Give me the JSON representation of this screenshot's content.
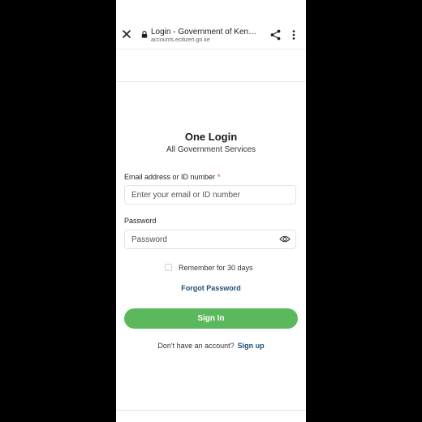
{
  "browser": {
    "page_title": "Login - Government of Kenya ...",
    "domain": "accounts.ecitizen.go.ke",
    "icons": {
      "close": "close-icon",
      "lock": "lock-icon",
      "share": "share-icon",
      "menu": "more-vert-icon"
    }
  },
  "login": {
    "title": "One Login",
    "subtitle": "All Government Services",
    "email_label": "Email address or ID number",
    "required_mark": "*",
    "email_placeholder": "Enter your email or ID number",
    "email_value": "",
    "password_label": "Password",
    "password_placeholder": "Password",
    "password_value": "",
    "remember_label": "Remember for 30 days",
    "remember_checked": false,
    "forgot_label": "Forgot Password",
    "signin_label": "Sign In",
    "no_account_text": "Don't have an account?",
    "signup_label": "Sign up"
  },
  "colors": {
    "primary_button": "#5cb85c",
    "link": "#1f4e79",
    "required": "#d93025"
  }
}
